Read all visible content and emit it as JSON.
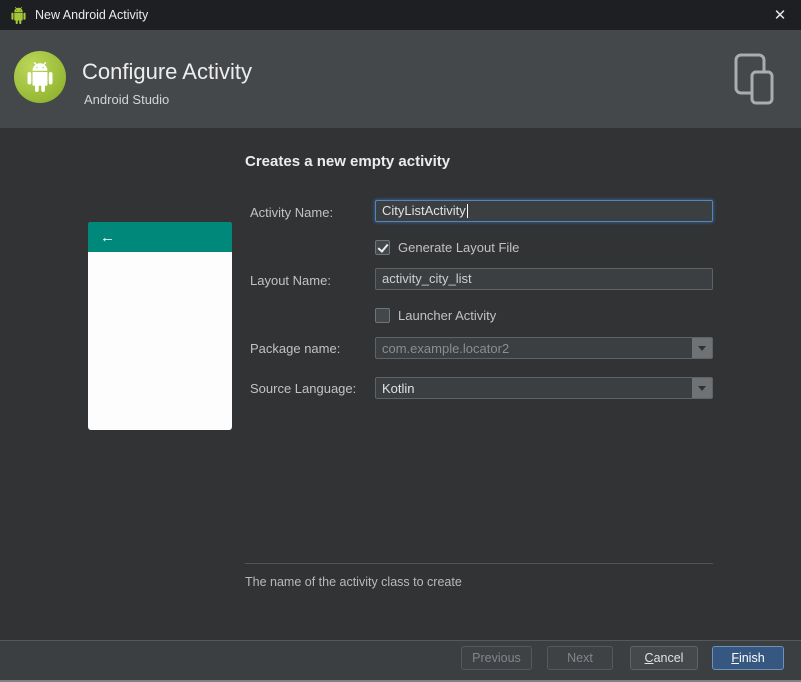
{
  "window": {
    "title": "New Android Activity"
  },
  "icons": {
    "close": "✕",
    "back_arrow": "←"
  },
  "header": {
    "title": "Configure Activity",
    "subtitle": "Android Studio"
  },
  "main": {
    "heading": "Creates a new empty activity",
    "fields": {
      "activity_name": {
        "label": "Activity Name:",
        "value": "CityListActivity"
      },
      "generate_layout_file": {
        "label": "Generate Layout File",
        "checked": true
      },
      "layout_name": {
        "label": "Layout Name:",
        "value": "activity_city_list"
      },
      "launcher_activity": {
        "label": "Launcher Activity",
        "checked": false
      },
      "package_name": {
        "label": "Package name:",
        "value": "com.example.locator2"
      },
      "source_language": {
        "label": "Source Language:",
        "value": "Kotlin"
      }
    },
    "hint": "The name of the activity class to create"
  },
  "footer": {
    "previous": "Previous",
    "next": "Next",
    "cancel_mnemonic": "C",
    "cancel_rest": "ancel",
    "finish_mnemonic": "F",
    "finish_rest": "inish"
  },
  "colors": {
    "teal_header": "#00897b",
    "android_green": "#a4c639",
    "accent_blue": "#365880",
    "focus_border": "#4e87c0"
  }
}
